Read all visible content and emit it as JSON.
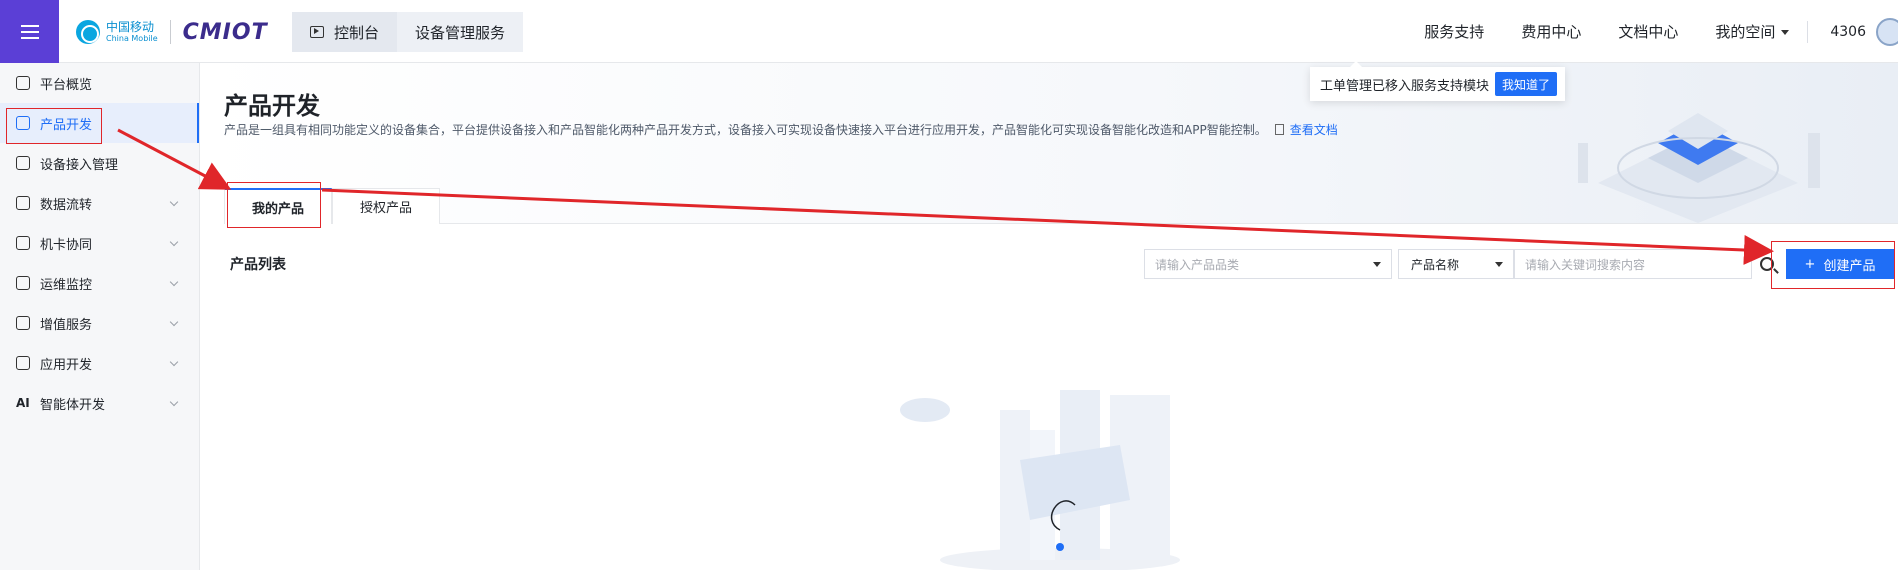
{
  "header": {
    "logo": {
      "cn": "中国移动",
      "en": "China Mobile",
      "brand": "CMIOT"
    },
    "breadcrumb": [
      "控制台",
      "设备管理服务"
    ],
    "nav": [
      "服务支持",
      "费用中心",
      "文档中心",
      "我的空间"
    ],
    "account": "4306"
  },
  "sidebar": {
    "items": [
      {
        "label": "平台概览",
        "icon": "overview-icon"
      },
      {
        "label": "产品开发",
        "icon": "cube-icon"
      },
      {
        "label": "设备接入管理",
        "icon": "device-icon"
      },
      {
        "label": "数据流转",
        "icon": "flow-icon"
      },
      {
        "label": "机卡协同",
        "icon": "card-icon"
      },
      {
        "label": "运维监控",
        "icon": "monitor-icon"
      },
      {
        "label": "增值服务",
        "icon": "send-icon"
      },
      {
        "label": "应用开发",
        "icon": "app-icon"
      },
      {
        "label": "智能体开发",
        "icon": "ai-icon",
        "glyph": "AI"
      }
    ],
    "active": "产品开发"
  },
  "page": {
    "title": "产品开发",
    "description": "产品是一组具有相同功能定义的设备集合，平台提供设备接入和产品智能化两种产品开发方式，设备接入可实现设备快速接入平台进行应用开发，产品智能化可实现设备智能化改造和APP智能控制。",
    "doc_link": "查看文档"
  },
  "tooltip": {
    "text": "工单管理已移入服务支持模块",
    "button": "我知道了"
  },
  "tabs": [
    "我的产品",
    "授权产品"
  ],
  "list": {
    "title": "产品列表",
    "category_placeholder": "请输入产品品类",
    "field_select": "产品名称",
    "keyword_placeholder": "请输入关键词搜索内容",
    "create_button": "创建产品",
    "create_prefix": "+"
  },
  "colors": {
    "brand_purple": "#5b3fd6",
    "primary": "#1f6ef6",
    "annotation_red": "#e0262a"
  }
}
